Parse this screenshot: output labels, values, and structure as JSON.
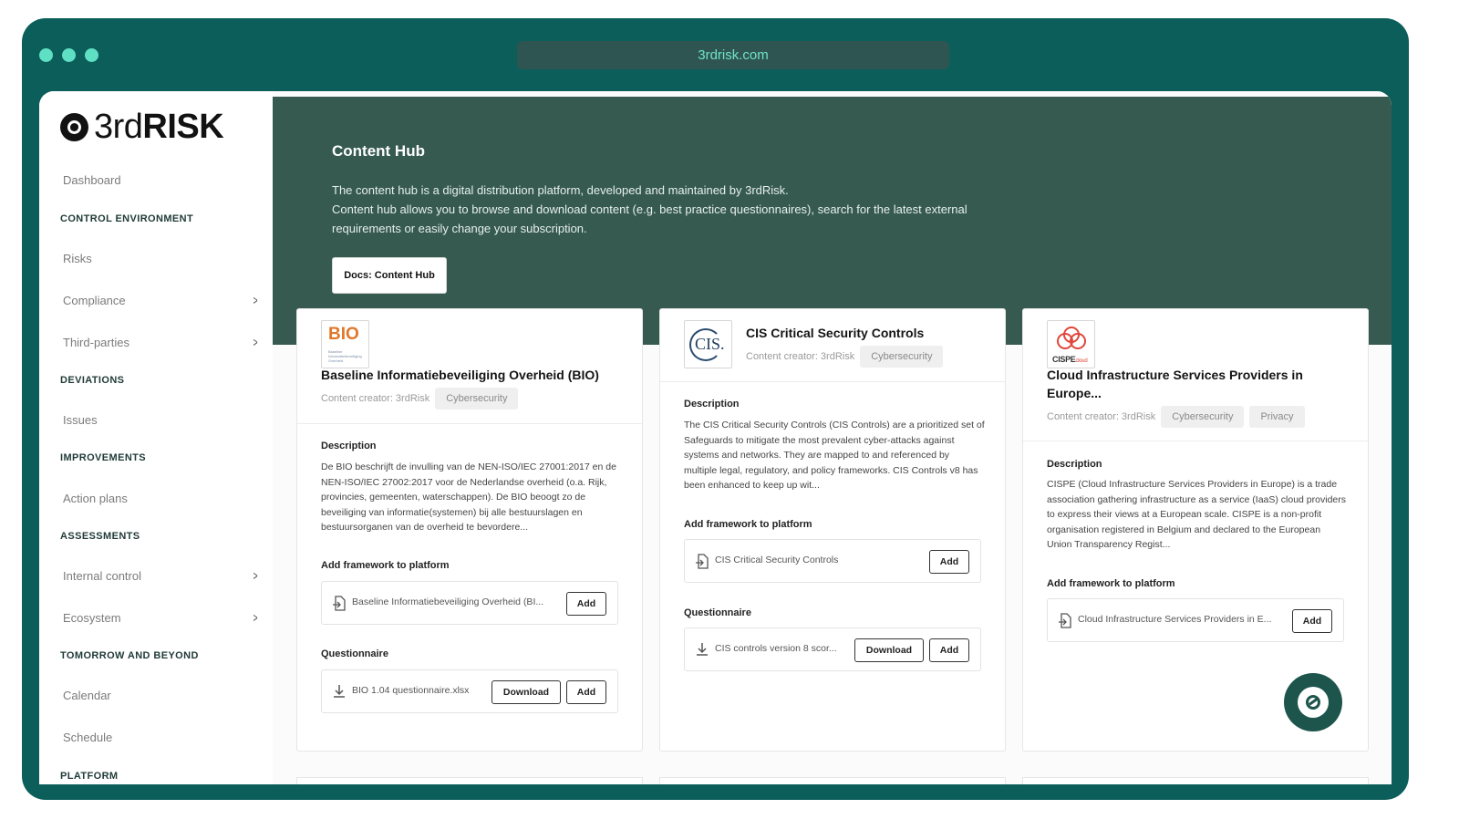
{
  "browser": {
    "url": "3rdrisk.com"
  },
  "brand": {
    "logo_light": "3rd",
    "logo_bold": "RISK"
  },
  "sidebar": {
    "dashboard": "Dashboard",
    "control_environment": "CONTROL ENVIRONMENT",
    "risks": "Risks",
    "compliance": "Compliance",
    "third_parties": "Third-parties",
    "deviations": "DEVIATIONS",
    "issues": "Issues",
    "improvements": "IMPROVEMENTS",
    "action_plans": "Action plans",
    "assessments": "ASSESSMENTS",
    "internal_control": "Internal control",
    "ecosystem": "Ecosystem",
    "tomorrow_and_beyond": "TOMORROW AND BEYOND",
    "calendar": "Calendar",
    "schedule": "Schedule",
    "platform": "PLATFORM"
  },
  "hero": {
    "title": "Content Hub",
    "line1": "The content hub is a digital distribution platform, developed and maintained by 3rdRisk.",
    "line2": "Content hub allows you to browse and download content (e.g. best practice questionnaires), search for the latest external requirements or easily change your subscription.",
    "docs_button": "Docs: Content Hub"
  },
  "cards": [
    {
      "logo_text": "BIO",
      "logo_sub": "Baseline Informatiebeveiliging Overheid",
      "title": "Baseline Informatiebeveiliging Overheid (BIO)",
      "creator": "Content creator: 3rdRisk",
      "tags": [
        "Cybersecurity"
      ],
      "description_label": "Description",
      "description": "De BIO beschrijft de invulling van de NEN-ISO/IEC 27001:2017 en de NEN-ISO/IEC 27002:2017 voor de Nederlandse overheid (o.a. Rijk, provincies, gemeenten, waterschappen). De BIO beoogt zo de beveiliging van informatie(systemen) bij alle bestuurslagen en bestuursorganen van de overheid te bevordere...",
      "framework_label": "Add framework to platform",
      "framework_name": "Baseline Informatiebeveiliging Overheid (BI...",
      "add_label": "Add",
      "questionnaire_label": "Questionnaire",
      "questionnaire_name": "BIO 1.04 questionnaire.xlsx",
      "download_label": "Download"
    },
    {
      "logo_text": "CIS.",
      "title": "CIS Critical Security Controls",
      "creator": "Content creator: 3rdRisk",
      "tags": [
        "Cybersecurity"
      ],
      "description_label": "Description",
      "description": "The CIS Critical Security Controls (CIS Controls) are a prioritized set of Safeguards to mitigate the most prevalent cyber-attacks against systems and networks. They are mapped to and referenced by multiple legal, regulatory, and policy frameworks. CIS Controls v8 has been enhanced to keep up wit...",
      "framework_label": "Add framework to platform",
      "framework_name": "CIS Critical Security Controls",
      "add_label": "Add",
      "questionnaire_label": "Questionnaire",
      "questionnaire_name": "CIS controls version 8 scor...",
      "download_label": "Download"
    },
    {
      "logo_text": "CISPE",
      "logo_sub": "cloud",
      "title": "Cloud Infrastructure Services Providers in Europe...",
      "creator": "Content creator: 3rdRisk",
      "tags": [
        "Cybersecurity",
        "Privacy"
      ],
      "description_label": "Description",
      "description": "CISPE (Cloud Infrastructure Services Providers in Europe) is a trade association gathering infrastructure as a service (IaaS) cloud providers to express their views at a European scale. CISPE is a non-profit organisation registered in Belgium and declared to the European Union Transparency Regist...",
      "framework_label": "Add framework to platform",
      "framework_name": "Cloud Infrastructure Services Providers in E...",
      "add_label": "Add"
    }
  ]
}
